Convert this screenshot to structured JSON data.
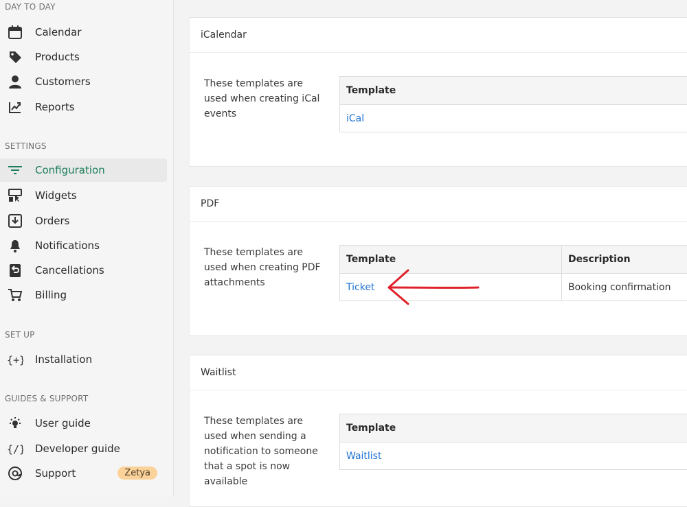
{
  "sidebar": {
    "sections": {
      "day_to_day": "DAY TO DAY",
      "settings": "SETTINGS",
      "set_up": "SET UP",
      "guides": "GUIDES & SUPPORT"
    },
    "items": {
      "calendar": "Calendar",
      "products": "Products",
      "customers": "Customers",
      "reports": "Reports",
      "configuration": "Configuration",
      "widgets": "Widgets",
      "orders": "Orders",
      "notifications": "Notifications",
      "cancellations": "Cancellations",
      "billing": "Billing",
      "installation": "Installation",
      "user_guide": "User guide",
      "developer_guide": "Developer guide",
      "support": "Support"
    },
    "support_badge": "Zetya",
    "active_color": "#1d7e5a"
  },
  "cards": {
    "ical": {
      "title": "iCalendar",
      "description": "These templates are used when creating iCal events",
      "col_template": "Template",
      "rows": [
        {
          "template": "iCal"
        }
      ]
    },
    "pdf": {
      "title": "PDF",
      "description": "These templates are used when creating PDF attachments",
      "col_template": "Template",
      "col_description": "Description",
      "rows": [
        {
          "template": "Ticket",
          "description": "Booking confirmation"
        }
      ]
    },
    "waitlist": {
      "title": "Waitlist",
      "description": "These templates are used when sending a notification to someone that a spot is now available",
      "col_template": "Template",
      "rows": [
        {
          "template": "Waitlist"
        }
      ]
    }
  },
  "annotation": {
    "arrow_color": "#e0202a",
    "target": "Ticket"
  }
}
